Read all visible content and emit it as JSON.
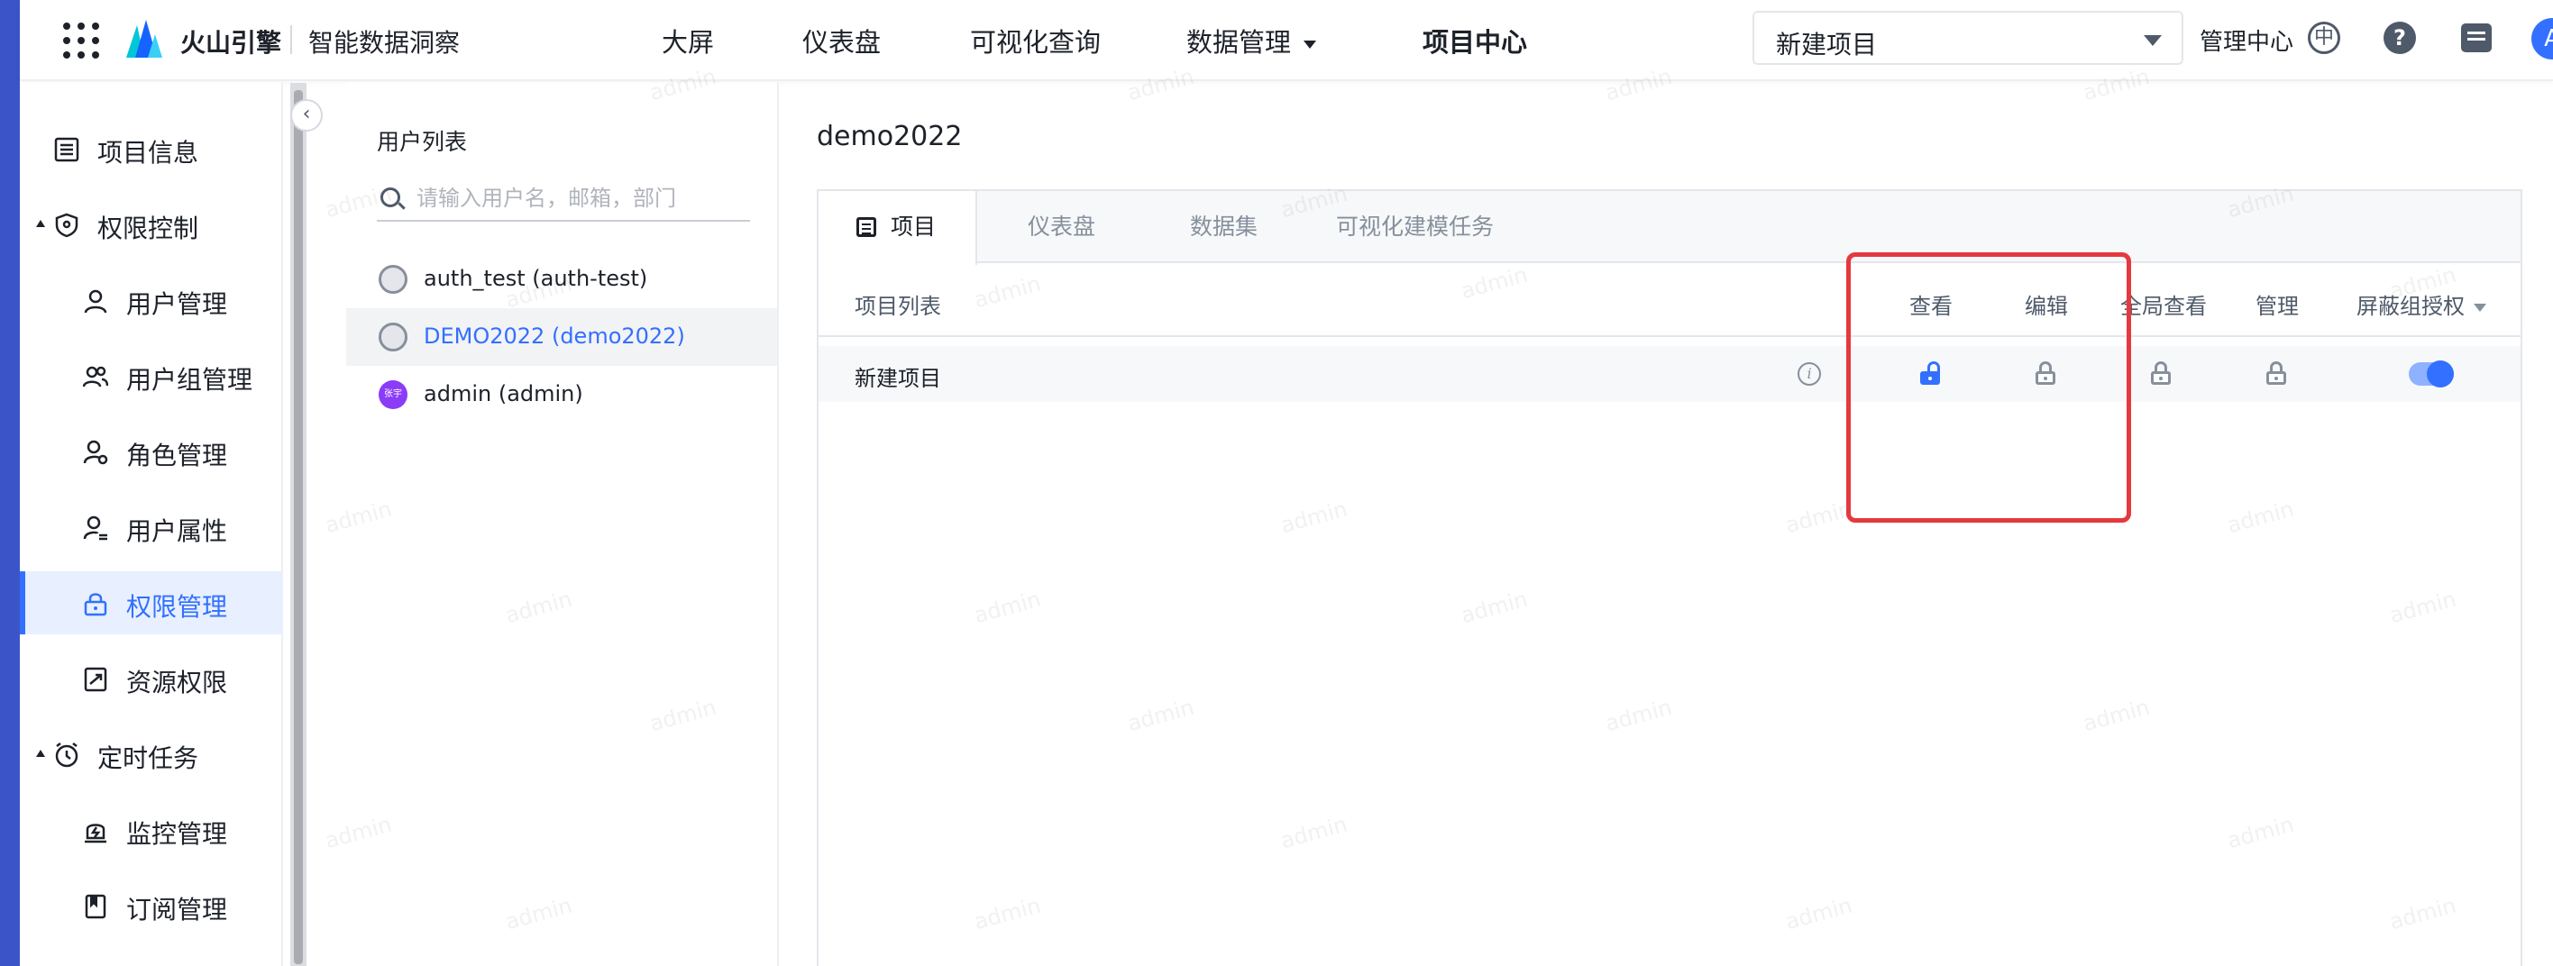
{
  "topbar": {
    "brand": "火山引擎",
    "product": "智能数据洞察",
    "nav": [
      "大屏",
      "仪表盘",
      "可视化查询",
      "数据管理",
      "项目中心"
    ],
    "project_select_value": "新建项目",
    "admin_center": "管理中心",
    "lang_icon_glyph": "中",
    "help_glyph": "?",
    "avatar_letter": "A"
  },
  "sidebar": {
    "items": [
      {
        "label": "项目信息",
        "icon": "list-icon"
      },
      {
        "label": "权限控制",
        "icon": "shield-icon",
        "expanded": true
      },
      {
        "label": "用户管理",
        "icon": "user-icon"
      },
      {
        "label": "用户组管理",
        "icon": "user-group-icon"
      },
      {
        "label": "角色管理",
        "icon": "role-icon"
      },
      {
        "label": "用户属性",
        "icon": "user-attr-icon"
      },
      {
        "label": "权限管理",
        "icon": "lock-icon",
        "active": true
      },
      {
        "label": "资源权限",
        "icon": "resource-icon"
      },
      {
        "label": "定时任务",
        "icon": "clock-icon",
        "expanded": true
      },
      {
        "label": "监控管理",
        "icon": "monitor-icon"
      },
      {
        "label": "订阅管理",
        "icon": "bookmark-icon"
      }
    ]
  },
  "userpanel": {
    "title": "用户列表",
    "search_placeholder": "请输入用户名，邮箱，部门",
    "users": [
      {
        "name": "auth_test (auth-test)"
      },
      {
        "name": "DEMO2022 (demo2022)",
        "selected": true
      },
      {
        "name": "admin (admin)",
        "avatar_text": "张宇"
      }
    ]
  },
  "main": {
    "title": "demo2022",
    "tabs": [
      "项目",
      "仪表盘",
      "数据集",
      "可视化建模任务"
    ],
    "table": {
      "headers": [
        "项目列表",
        "查看",
        "编辑",
        "全局查看",
        "管理",
        "屏蔽组授权"
      ],
      "rows": [
        {
          "name": "新建项目",
          "info_glyph": "i",
          "view": "unlocked",
          "edit": "locked",
          "global_view": "locked",
          "manage": "locked",
          "block_group_auth": true
        }
      ]
    }
  },
  "watermark": "admin",
  "colors": {
    "accent": "#3370ff",
    "highlight": "#e5393f",
    "left_strip": "#3b55c9"
  }
}
